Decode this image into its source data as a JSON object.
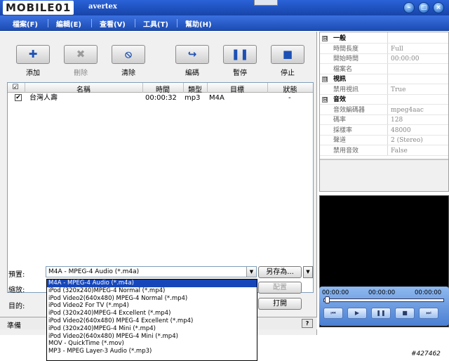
{
  "logo": "MOBILE01",
  "app_title": "avertex",
  "window_buttons": [
    "minimize-icon",
    "restore-icon",
    "close-icon"
  ],
  "window_glyphs": {
    "minimize": "–",
    "restore": "□",
    "close": "×"
  },
  "menu": [
    "檔案(F)",
    "編輯(E)",
    "查看(V)",
    "工具(T)",
    "幫助(H)"
  ],
  "toolbar": [
    {
      "label": "添加",
      "icon": "plus-icon",
      "glyph": "✚",
      "color": "#1d50b5"
    },
    {
      "label": "刪除",
      "icon": "delete-x-icon",
      "glyph": "✖",
      "color": "#9a9a9a"
    },
    {
      "label": "清除",
      "icon": "clear-no-icon",
      "glyph": "⦸",
      "color": "#1d50b5"
    },
    {
      "label": "編碼",
      "icon": "encode-arrow-icon",
      "glyph": "↪",
      "color": "#1d50b5"
    },
    {
      "label": "暫停",
      "icon": "pause-icon",
      "glyph": "❚❚",
      "color": "#1d50b5"
    },
    {
      "label": "停止",
      "icon": "stop-icon",
      "glyph": "■",
      "color": "#1d50b5"
    }
  ],
  "list": {
    "headers": {
      "check": "☑",
      "name": "名稱",
      "time": "時間",
      "type": "類型",
      "target": "目標",
      "status": "狀態"
    },
    "rows": [
      {
        "check": "✔",
        "name": "台灣人壽",
        "time": "00:00:32",
        "type": "mp3",
        "target": "M4A",
        "status": "-"
      }
    ]
  },
  "controls": {
    "preset_label": "預置:",
    "zoom_label": "縮放:",
    "target_label": "目的:",
    "preset_value": "M4A - MPEG-4 Audio  (*.m4a)",
    "preset_arrow": "▼",
    "save_as": "另存為...",
    "toggle_arrow": "▼",
    "config": "配置",
    "open": "打開"
  },
  "status": {
    "text": "準備",
    "help": "?"
  },
  "dropdown_options": [
    "M4A - MPEG-4 Audio  (*.m4a)",
    "iPod (320x240)MPEG-4 Normal  (*.mp4)",
    "iPod Video2(640x480) MPEG-4 Normal  (*.mp4)",
    "iPod Video2 For TV  (*.mp4)",
    "iPod (320x240)MPEG-4 Excellent  (*.mp4)",
    "iPod Video2(640x480) MPEG-4 Excellent  (*.mp4)",
    "iPod (320x240)MPEG-4 Mini  (*.mp4)",
    "iPod Video2(640x480) MPEG-4 Mini  (*.mp4)",
    "MOV - QuickTime  (*.mov)",
    "MP3 - MPEG Layer-3 Audio  (*.mp3)"
  ],
  "properties": [
    {
      "group": true,
      "box": "⊟",
      "key": "一般"
    },
    {
      "key": "時間長度",
      "value": "Full"
    },
    {
      "key": "開始時間",
      "value": "00:00:00"
    },
    {
      "key": "檔案名",
      "value": ""
    },
    {
      "group": true,
      "box": "⊟",
      "key": "視訊"
    },
    {
      "key": "禁用視訊",
      "value": "True"
    },
    {
      "group": true,
      "box": "⊟",
      "key": "音效"
    },
    {
      "key": "音效編碼器",
      "value": "mpeg4aac"
    },
    {
      "key": "碼率",
      "value": "128"
    },
    {
      "key": "採樣率",
      "value": "48000"
    },
    {
      "key": "聲道",
      "value": "2 (Stereo)"
    },
    {
      "key": "禁用音效",
      "value": "False"
    }
  ],
  "player": {
    "time_start": "00:00:00",
    "time_mid": "00:00:00",
    "time_end": "00:00:00",
    "position": 0,
    "buttons": [
      {
        "icon": "previous-icon",
        "glyph": "⏮"
      },
      {
        "icon": "play-icon",
        "glyph": "▶"
      },
      {
        "icon": "pause-icon",
        "glyph": "❚❚"
      },
      {
        "icon": "stop-icon",
        "glyph": "■"
      },
      {
        "icon": "next-icon",
        "glyph": "⏭"
      }
    ]
  },
  "watermark": "#427462"
}
